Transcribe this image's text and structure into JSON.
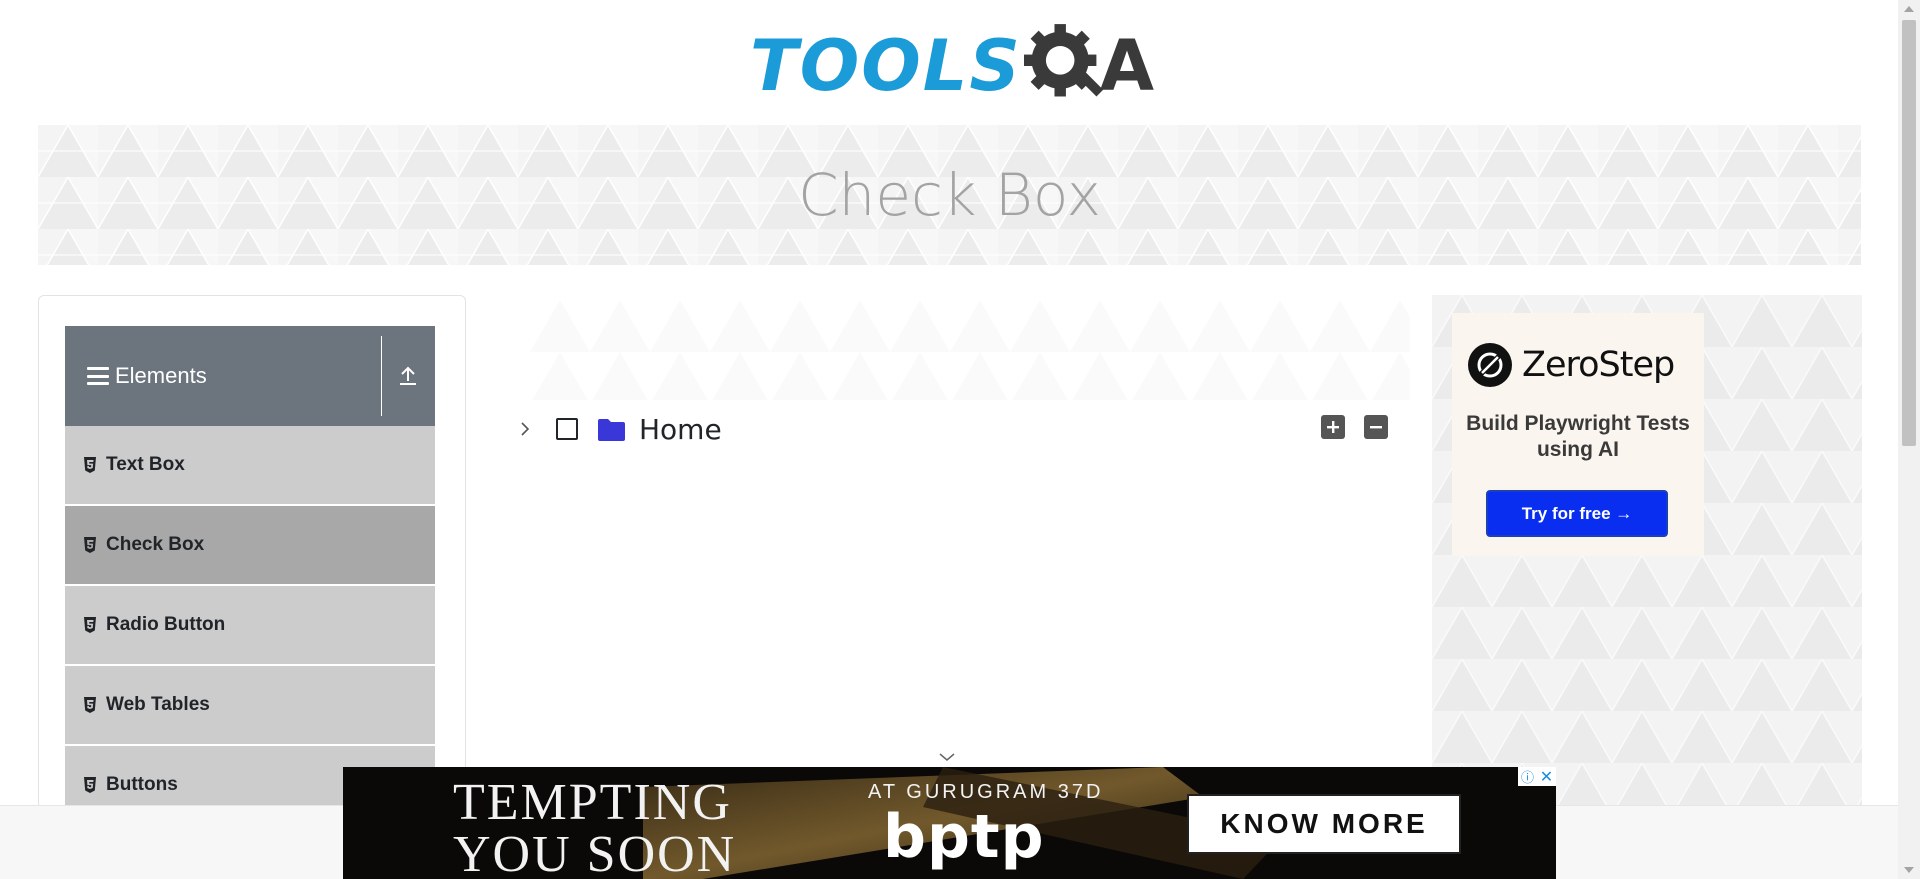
{
  "header": {
    "logo_text": "TOOLS",
    "logo_suffix": "A"
  },
  "banner": {
    "title": "Check Box"
  },
  "sidebar": {
    "group_title": "Elements",
    "items": [
      {
        "label": "Text Box",
        "icon": "html5-icon",
        "active": false
      },
      {
        "label": "Check Box",
        "icon": "html5-icon",
        "active": true
      },
      {
        "label": "Radio Button",
        "icon": "html5-icon",
        "active": false
      },
      {
        "label": "Web Tables",
        "icon": "html5-icon",
        "active": false
      },
      {
        "label": "Buttons",
        "icon": "html5-icon",
        "active": false
      }
    ]
  },
  "tree": {
    "root_label": "Home",
    "expanded": false,
    "checked": false,
    "expand_all_icon": "plus-icon",
    "collapse_all_icon": "minus-icon"
  },
  "right_ad": {
    "brand": "ZeroStep",
    "tagline": "Build Playwright Tests using AI",
    "cta": "Try for free →"
  },
  "bottom_ad": {
    "headline_line1": "TEMPTING",
    "headline_line2": "YOU SOON",
    "location": "AT GURUGRAM 37D",
    "brand": "bptp",
    "cta": "KNOW MORE",
    "adchoices_icon": "info-icon",
    "close_icon": "close-icon"
  },
  "colors": {
    "sidebar_header": "#6c757d",
    "menu_item": "#cccccc",
    "menu_item_active": "#a8a8a8",
    "folder": "#3a37d8",
    "logo_blue": "#1b9bd7",
    "ad_button": "#0a2ef0"
  }
}
